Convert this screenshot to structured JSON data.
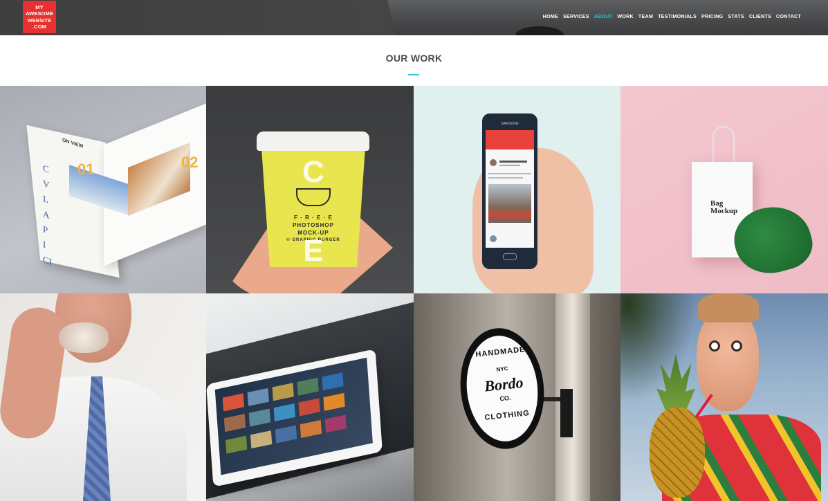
{
  "header": {
    "logo_lines": [
      "MY",
      "AWESOME",
      "WEBSITE",
      ".COM"
    ],
    "nav": [
      {
        "label": "HOME",
        "active": false
      },
      {
        "label": "SERVICES",
        "active": false
      },
      {
        "label": "ABOUT",
        "active": true
      },
      {
        "label": "WORK",
        "active": false
      },
      {
        "label": "TEAM",
        "active": false
      },
      {
        "label": "TESTIMONIALS",
        "active": false
      },
      {
        "label": "PRICING",
        "active": false
      },
      {
        "label": "STATS",
        "active": false
      },
      {
        "label": "CLIENTS",
        "active": false
      },
      {
        "label": "CONTACT",
        "active": false
      }
    ]
  },
  "section": {
    "title": "OUR WORK",
    "accent_color": "#34c3d7"
  },
  "portfolio": {
    "magazine": {
      "heading": "ON VIEW",
      "num1": "01",
      "num2": "02",
      "letters": [
        "C",
        "V",
        "L",
        "A",
        "P",
        "I",
        "CI"
      ]
    },
    "cup": {
      "big_top": "C",
      "big_bottom": "E",
      "lines": [
        "F · R · E · E",
        "PHOTOSHOP",
        "MOCK-UP",
        "© GRAPHIC BURGER"
      ]
    },
    "phone": {
      "brand": "SAMSUNG"
    },
    "bag": {
      "lines": [
        "Bag",
        "Mockup"
      ]
    },
    "sign": {
      "top": "HANDMADE",
      "mid1": "NYC",
      "mid2": "Bordo",
      "mid3": "CO.",
      "bottom": "CLOTHING"
    }
  },
  "colors": {
    "logo_bg": "#e8302e",
    "nav_active": "#34c3d7",
    "header_bg": "#404041"
  }
}
